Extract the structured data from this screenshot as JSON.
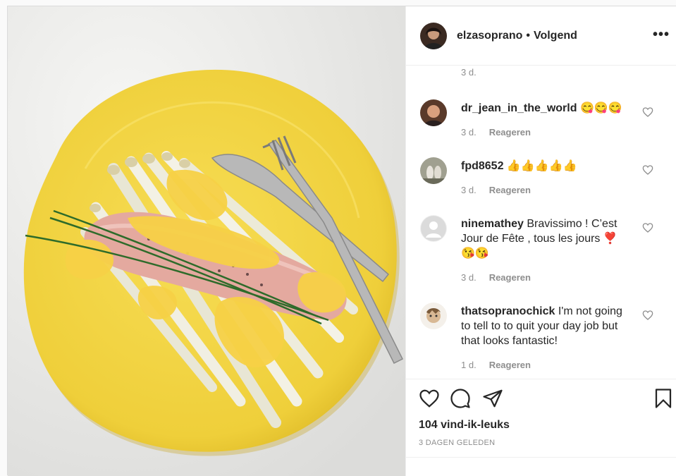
{
  "header": {
    "username": "elzasoprano",
    "separator": "•",
    "follow_status": "Volgend",
    "more_icon": "more-options-icon"
  },
  "top_comment_time": "3 d.",
  "reply_label": "Reageren",
  "comments": [
    {
      "user": "dr_jean_in_the_world",
      "text": "😋😋😋",
      "time": "3 d."
    },
    {
      "user": "fpd8652",
      "text": "👍👍👍👍👍",
      "time": "3 d."
    },
    {
      "user": "ninemathey",
      "text": "Bravissimo ! C’est Jour de Fête , tous les jours ❣️ 😘😘",
      "time": "3 d."
    },
    {
      "user": "thatsopranochick",
      "text": "I'm not going to tell to to quit your day job but that looks fantastic!",
      "time": "1 d."
    }
  ],
  "actions": {
    "like_icon": "heart-icon",
    "comment_icon": "comment-icon",
    "share_icon": "share-icon",
    "save_icon": "bookmark-icon"
  },
  "likes": "104 vind-ik-leuks",
  "date": "3 DAGEN GELEDEN",
  "colors": {
    "plate": "#f2d542",
    "sauce": "#f6d24a",
    "asparagus": "#f0eee0",
    "salmon": "#e8b0a8",
    "text_secondary": "#8e8e8e"
  }
}
